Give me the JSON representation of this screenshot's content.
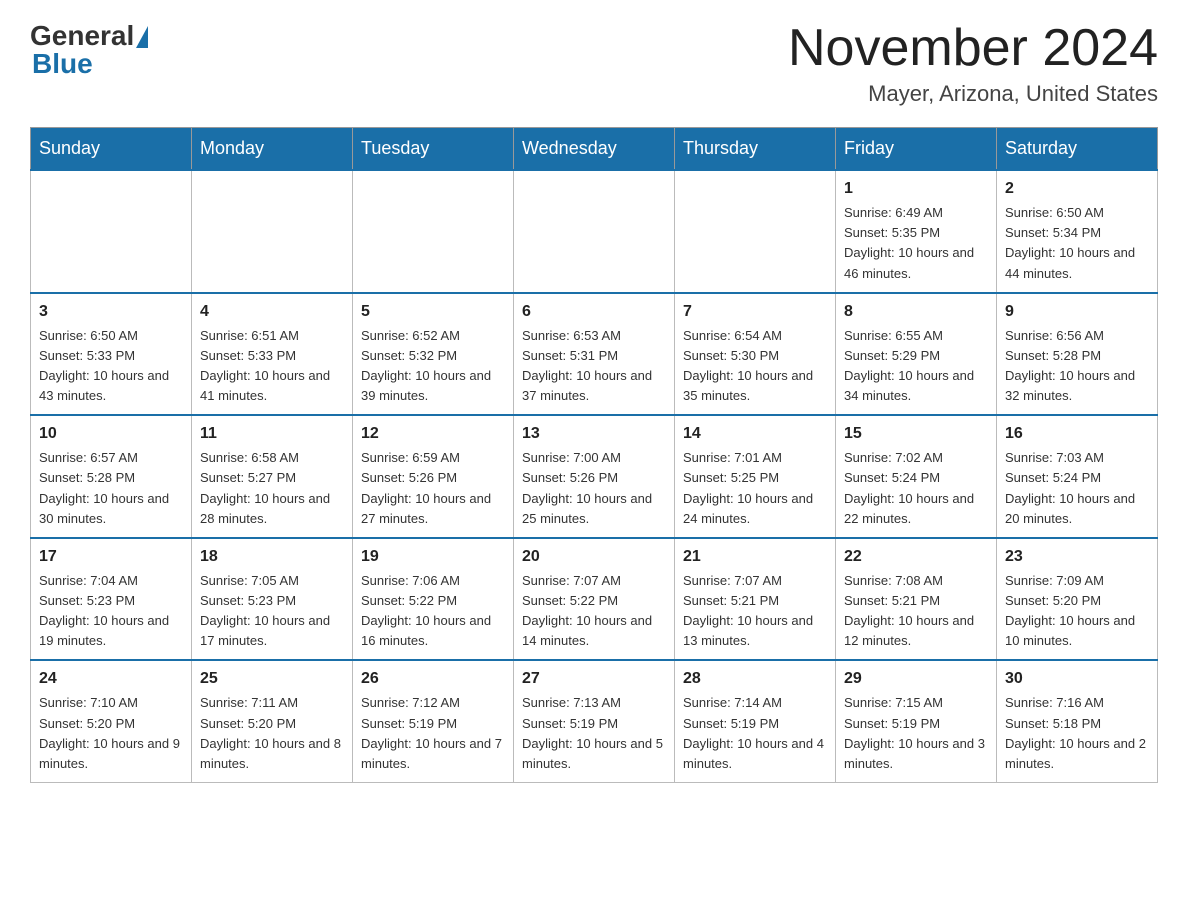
{
  "logo": {
    "general": "General",
    "blue": "Blue"
  },
  "header": {
    "month": "November 2024",
    "location": "Mayer, Arizona, United States"
  },
  "weekdays": [
    "Sunday",
    "Monday",
    "Tuesday",
    "Wednesday",
    "Thursday",
    "Friday",
    "Saturday"
  ],
  "weeks": [
    [
      {
        "day": "",
        "info": ""
      },
      {
        "day": "",
        "info": ""
      },
      {
        "day": "",
        "info": ""
      },
      {
        "day": "",
        "info": ""
      },
      {
        "day": "",
        "info": ""
      },
      {
        "day": "1",
        "info": "Sunrise: 6:49 AM\nSunset: 5:35 PM\nDaylight: 10 hours and 46 minutes."
      },
      {
        "day": "2",
        "info": "Sunrise: 6:50 AM\nSunset: 5:34 PM\nDaylight: 10 hours and 44 minutes."
      }
    ],
    [
      {
        "day": "3",
        "info": "Sunrise: 6:50 AM\nSunset: 5:33 PM\nDaylight: 10 hours and 43 minutes."
      },
      {
        "day": "4",
        "info": "Sunrise: 6:51 AM\nSunset: 5:33 PM\nDaylight: 10 hours and 41 minutes."
      },
      {
        "day": "5",
        "info": "Sunrise: 6:52 AM\nSunset: 5:32 PM\nDaylight: 10 hours and 39 minutes."
      },
      {
        "day": "6",
        "info": "Sunrise: 6:53 AM\nSunset: 5:31 PM\nDaylight: 10 hours and 37 minutes."
      },
      {
        "day": "7",
        "info": "Sunrise: 6:54 AM\nSunset: 5:30 PM\nDaylight: 10 hours and 35 minutes."
      },
      {
        "day": "8",
        "info": "Sunrise: 6:55 AM\nSunset: 5:29 PM\nDaylight: 10 hours and 34 minutes."
      },
      {
        "day": "9",
        "info": "Sunrise: 6:56 AM\nSunset: 5:28 PM\nDaylight: 10 hours and 32 minutes."
      }
    ],
    [
      {
        "day": "10",
        "info": "Sunrise: 6:57 AM\nSunset: 5:28 PM\nDaylight: 10 hours and 30 minutes."
      },
      {
        "day": "11",
        "info": "Sunrise: 6:58 AM\nSunset: 5:27 PM\nDaylight: 10 hours and 28 minutes."
      },
      {
        "day": "12",
        "info": "Sunrise: 6:59 AM\nSunset: 5:26 PM\nDaylight: 10 hours and 27 minutes."
      },
      {
        "day": "13",
        "info": "Sunrise: 7:00 AM\nSunset: 5:26 PM\nDaylight: 10 hours and 25 minutes."
      },
      {
        "day": "14",
        "info": "Sunrise: 7:01 AM\nSunset: 5:25 PM\nDaylight: 10 hours and 24 minutes."
      },
      {
        "day": "15",
        "info": "Sunrise: 7:02 AM\nSunset: 5:24 PM\nDaylight: 10 hours and 22 minutes."
      },
      {
        "day": "16",
        "info": "Sunrise: 7:03 AM\nSunset: 5:24 PM\nDaylight: 10 hours and 20 minutes."
      }
    ],
    [
      {
        "day": "17",
        "info": "Sunrise: 7:04 AM\nSunset: 5:23 PM\nDaylight: 10 hours and 19 minutes."
      },
      {
        "day": "18",
        "info": "Sunrise: 7:05 AM\nSunset: 5:23 PM\nDaylight: 10 hours and 17 minutes."
      },
      {
        "day": "19",
        "info": "Sunrise: 7:06 AM\nSunset: 5:22 PM\nDaylight: 10 hours and 16 minutes."
      },
      {
        "day": "20",
        "info": "Sunrise: 7:07 AM\nSunset: 5:22 PM\nDaylight: 10 hours and 14 minutes."
      },
      {
        "day": "21",
        "info": "Sunrise: 7:07 AM\nSunset: 5:21 PM\nDaylight: 10 hours and 13 minutes."
      },
      {
        "day": "22",
        "info": "Sunrise: 7:08 AM\nSunset: 5:21 PM\nDaylight: 10 hours and 12 minutes."
      },
      {
        "day": "23",
        "info": "Sunrise: 7:09 AM\nSunset: 5:20 PM\nDaylight: 10 hours and 10 minutes."
      }
    ],
    [
      {
        "day": "24",
        "info": "Sunrise: 7:10 AM\nSunset: 5:20 PM\nDaylight: 10 hours and 9 minutes."
      },
      {
        "day": "25",
        "info": "Sunrise: 7:11 AM\nSunset: 5:20 PM\nDaylight: 10 hours and 8 minutes."
      },
      {
        "day": "26",
        "info": "Sunrise: 7:12 AM\nSunset: 5:19 PM\nDaylight: 10 hours and 7 minutes."
      },
      {
        "day": "27",
        "info": "Sunrise: 7:13 AM\nSunset: 5:19 PM\nDaylight: 10 hours and 5 minutes."
      },
      {
        "day": "28",
        "info": "Sunrise: 7:14 AM\nSunset: 5:19 PM\nDaylight: 10 hours and 4 minutes."
      },
      {
        "day": "29",
        "info": "Sunrise: 7:15 AM\nSunset: 5:19 PM\nDaylight: 10 hours and 3 minutes."
      },
      {
        "day": "30",
        "info": "Sunrise: 7:16 AM\nSunset: 5:18 PM\nDaylight: 10 hours and 2 minutes."
      }
    ]
  ]
}
